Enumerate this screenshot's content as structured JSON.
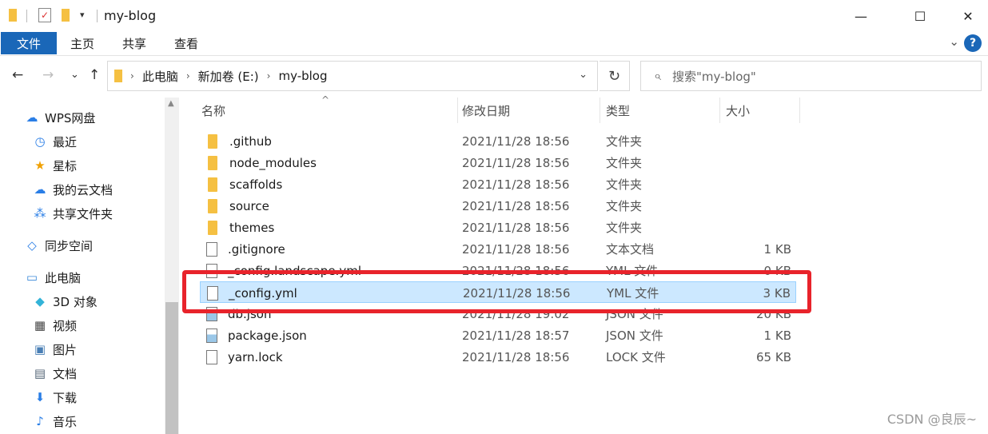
{
  "window": {
    "title": "my-blog",
    "minimize": "—",
    "maximize": "☐",
    "close": "✕"
  },
  "ribbon": {
    "tabs": [
      "文件",
      "主页",
      "共享",
      "查看"
    ],
    "collapse": "⌄",
    "help": "?"
  },
  "nav": {
    "back": "←",
    "forward": "→",
    "recent": "⌄",
    "up": "↑",
    "breadcrumbs": [
      "此电脑",
      "新加卷 (E:)",
      "my-blog"
    ],
    "dropdown": "⌄",
    "refresh": "↻",
    "search_placeholder": "搜索\"my-blog\""
  },
  "sidebar": {
    "items": [
      {
        "label": "WPS网盘",
        "icon": "cloud-icon",
        "glyph": "☁",
        "color": "#2a7ee6"
      },
      {
        "label": "最近",
        "icon": "clock-icon",
        "glyph": "◷",
        "color": "#2a7ee6"
      },
      {
        "label": "星标",
        "icon": "star-icon",
        "glyph": "★",
        "color": "#f0a000"
      },
      {
        "label": "我的云文档",
        "icon": "cloud-doc-icon",
        "glyph": "☁",
        "color": "#2a7ee6"
      },
      {
        "label": "共享文件夹",
        "icon": "share-folder-icon",
        "glyph": "⁂",
        "color": "#2a7ee6"
      },
      {
        "label": "同步空间",
        "icon": "sync-icon",
        "glyph": "◇",
        "color": "#2a7ee6"
      },
      {
        "label": "此电脑",
        "icon": "computer-icon",
        "glyph": "▭",
        "color": "#3b8ad9"
      },
      {
        "label": "3D 对象",
        "icon": "cube-icon",
        "glyph": "◆",
        "color": "#33b3d8"
      },
      {
        "label": "视频",
        "icon": "film-icon",
        "glyph": "▦",
        "color": "#444444"
      },
      {
        "label": "图片",
        "icon": "picture-icon",
        "glyph": "▣",
        "color": "#4a7fb5"
      },
      {
        "label": "文档",
        "icon": "document-icon",
        "glyph": "▤",
        "color": "#556677"
      },
      {
        "label": "下载",
        "icon": "download-icon",
        "glyph": "⬇",
        "color": "#2a7ee6"
      },
      {
        "label": "音乐",
        "icon": "music-icon",
        "glyph": "♪",
        "color": "#2a7ee6"
      }
    ]
  },
  "columns": {
    "name": "名称",
    "date": "修改日期",
    "type": "类型",
    "size": "大小",
    "sort_indicator": "^"
  },
  "files": [
    {
      "name": ".github",
      "date": "2021/11/28 18:56",
      "type": "文件夹",
      "size": "",
      "icon": "folder-icon",
      "kind": "folder"
    },
    {
      "name": "node_modules",
      "date": "2021/11/28 18:56",
      "type": "文件夹",
      "size": "",
      "icon": "folder-icon",
      "kind": "folder"
    },
    {
      "name": "scaffolds",
      "date": "2021/11/28 18:56",
      "type": "文件夹",
      "size": "",
      "icon": "folder-icon",
      "kind": "folder"
    },
    {
      "name": "source",
      "date": "2021/11/28 18:56",
      "type": "文件夹",
      "size": "",
      "icon": "folder-icon",
      "kind": "folder"
    },
    {
      "name": "themes",
      "date": "2021/11/28 18:56",
      "type": "文件夹",
      "size": "",
      "icon": "folder-icon",
      "kind": "folder"
    },
    {
      "name": ".gitignore",
      "date": "2021/11/28 18:56",
      "type": "文本文档",
      "size": "1 KB",
      "icon": "text-file-icon",
      "kind": "doc"
    },
    {
      "name": "_config.landscape.yml",
      "date": "2021/11/28 18:56",
      "type": "YML 文件",
      "size": "0 KB",
      "icon": "file-icon",
      "kind": "doc"
    },
    {
      "name": "_config.yml",
      "date": "2021/11/28 18:56",
      "type": "YML 文件",
      "size": "3 KB",
      "icon": "file-icon",
      "kind": "doc",
      "selected": true
    },
    {
      "name": "db.json",
      "date": "2021/11/28 19:02",
      "type": "JSON 文件",
      "size": "20 KB",
      "icon": "json-file-icon",
      "kind": "json"
    },
    {
      "name": "package.json",
      "date": "2021/11/28 18:57",
      "type": "JSON 文件",
      "size": "1 KB",
      "icon": "json-file-icon",
      "kind": "json"
    },
    {
      "name": "yarn.lock",
      "date": "2021/11/28 18:56",
      "type": "LOCK 文件",
      "size": "65 KB",
      "icon": "file-icon",
      "kind": "doc"
    }
  ],
  "watermark": "CSDN @良辰~",
  "colors": {
    "accent": "#1a67b8",
    "selection": "#cce8ff",
    "highlight_box": "#e8232b"
  }
}
